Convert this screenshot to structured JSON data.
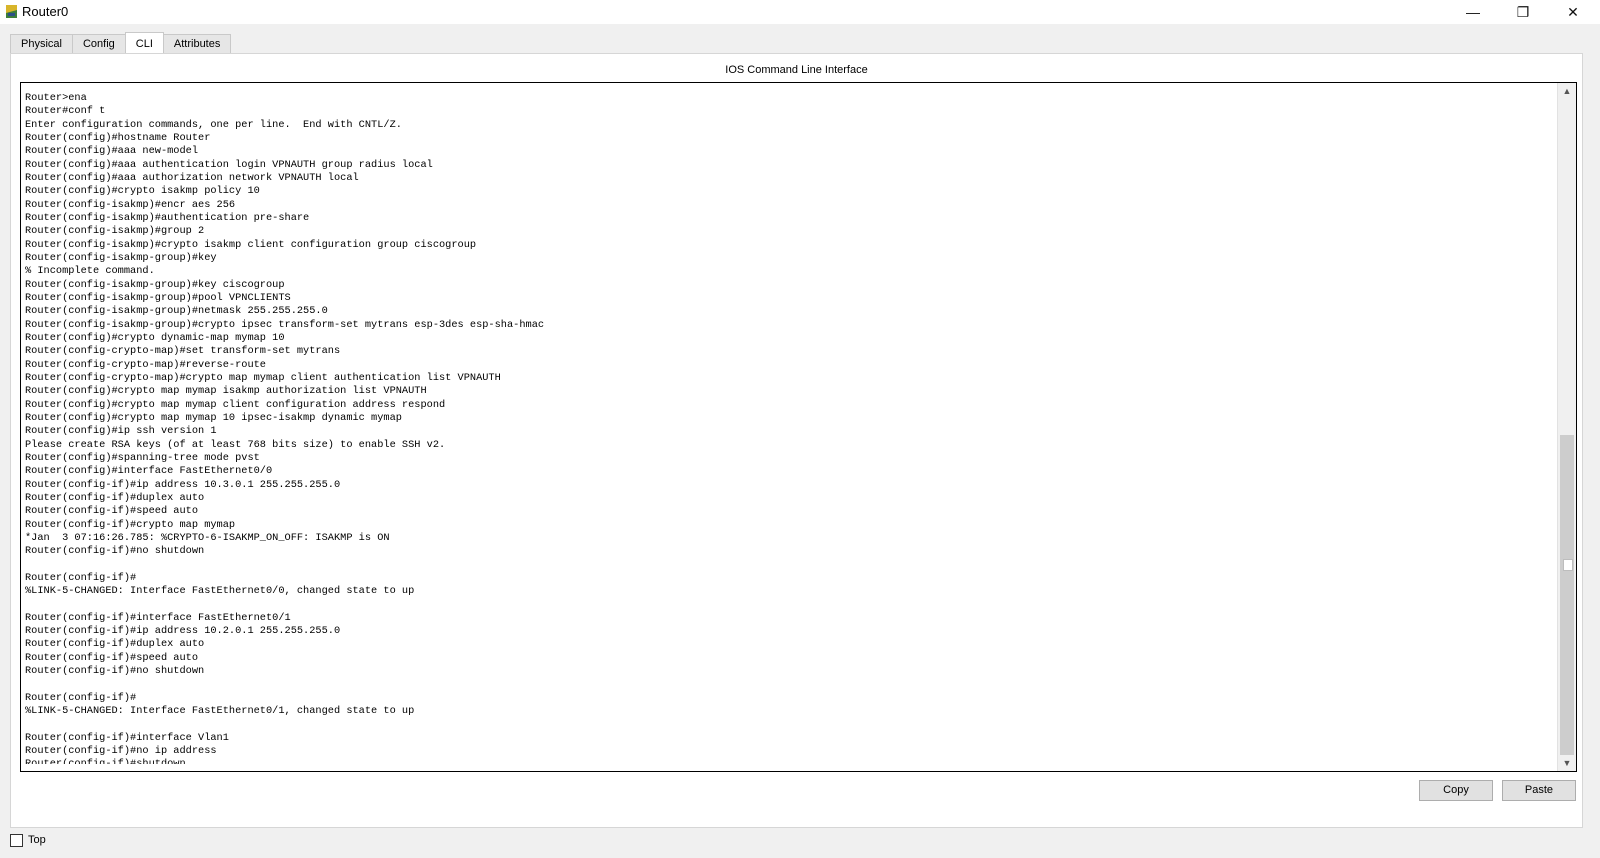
{
  "window": {
    "title": "Router0",
    "controls": {
      "minimize": "—",
      "maximize": "❐",
      "close": "✕"
    }
  },
  "tabs": [
    {
      "label": "Physical",
      "active": false
    },
    {
      "label": "Config",
      "active": false
    },
    {
      "label": "CLI",
      "active": true
    },
    {
      "label": "Attributes",
      "active": false
    }
  ],
  "cli": {
    "heading": "IOS Command Line Interface",
    "text": "Router>ena\nRouter#conf t\nEnter configuration commands, one per line.  End with CNTL/Z.\nRouter(config)#hostname Router\nRouter(config)#aaa new-model\nRouter(config)#aaa authentication login VPNAUTH group radius local\nRouter(config)#aaa authorization network VPNAUTH local\nRouter(config)#crypto isakmp policy 10\nRouter(config-isakmp)#encr aes 256\nRouter(config-isakmp)#authentication pre-share\nRouter(config-isakmp)#group 2\nRouter(config-isakmp)#crypto isakmp client configuration group ciscogroup\nRouter(config-isakmp-group)#key\n% Incomplete command.\nRouter(config-isakmp-group)#key ciscogroup\nRouter(config-isakmp-group)#pool VPNCLIENTS\nRouter(config-isakmp-group)#netmask 255.255.255.0\nRouter(config-isakmp-group)#crypto ipsec transform-set mytrans esp-3des esp-sha-hmac\nRouter(config)#crypto dynamic-map mymap 10\nRouter(config-crypto-map)#set transform-set mytrans\nRouter(config-crypto-map)#reverse-route\nRouter(config-crypto-map)#crypto map mymap client authentication list VPNAUTH\nRouter(config)#crypto map mymap isakmp authorization list VPNAUTH\nRouter(config)#crypto map mymap client configuration address respond\nRouter(config)#crypto map mymap 10 ipsec-isakmp dynamic mymap\nRouter(config)#ip ssh version 1\nPlease create RSA keys (of at least 768 bits size) to enable SSH v2.\nRouter(config)#spanning-tree mode pvst\nRouter(config)#interface FastEthernet0/0\nRouter(config-if)#ip address 10.3.0.1 255.255.255.0\nRouter(config-if)#duplex auto\nRouter(config-if)#speed auto\nRouter(config-if)#crypto map mymap\n*Jan  3 07:16:26.785: %CRYPTO-6-ISAKMP_ON_OFF: ISAKMP is ON\nRouter(config-if)#no shutdown\n\nRouter(config-if)#\n%LINK-5-CHANGED: Interface FastEthernet0/0, changed state to up\n\nRouter(config-if)#interface FastEthernet0/1\nRouter(config-if)#ip address 10.2.0.1 255.255.255.0\nRouter(config-if)#duplex auto\nRouter(config-if)#speed auto\nRouter(config-if)#no shutdown\n\nRouter(config-if)#\n%LINK-5-CHANGED: Interface FastEthernet0/1, changed state to up\n\nRouter(config-if)#interface Vlan1\nRouter(config-if)#no ip address\nRouter(config-if)#shutdown",
    "scroll_up_icon": "▲",
    "scroll_down_icon": "▼"
  },
  "buttons": {
    "copy": "Copy",
    "paste": "Paste"
  },
  "footer": {
    "top_label": "Top",
    "top_checked": false
  },
  "colors": {
    "background": "#f0f0f0",
    "panel": "#ffffff",
    "scroll_thumb": "#cdcdcd"
  }
}
